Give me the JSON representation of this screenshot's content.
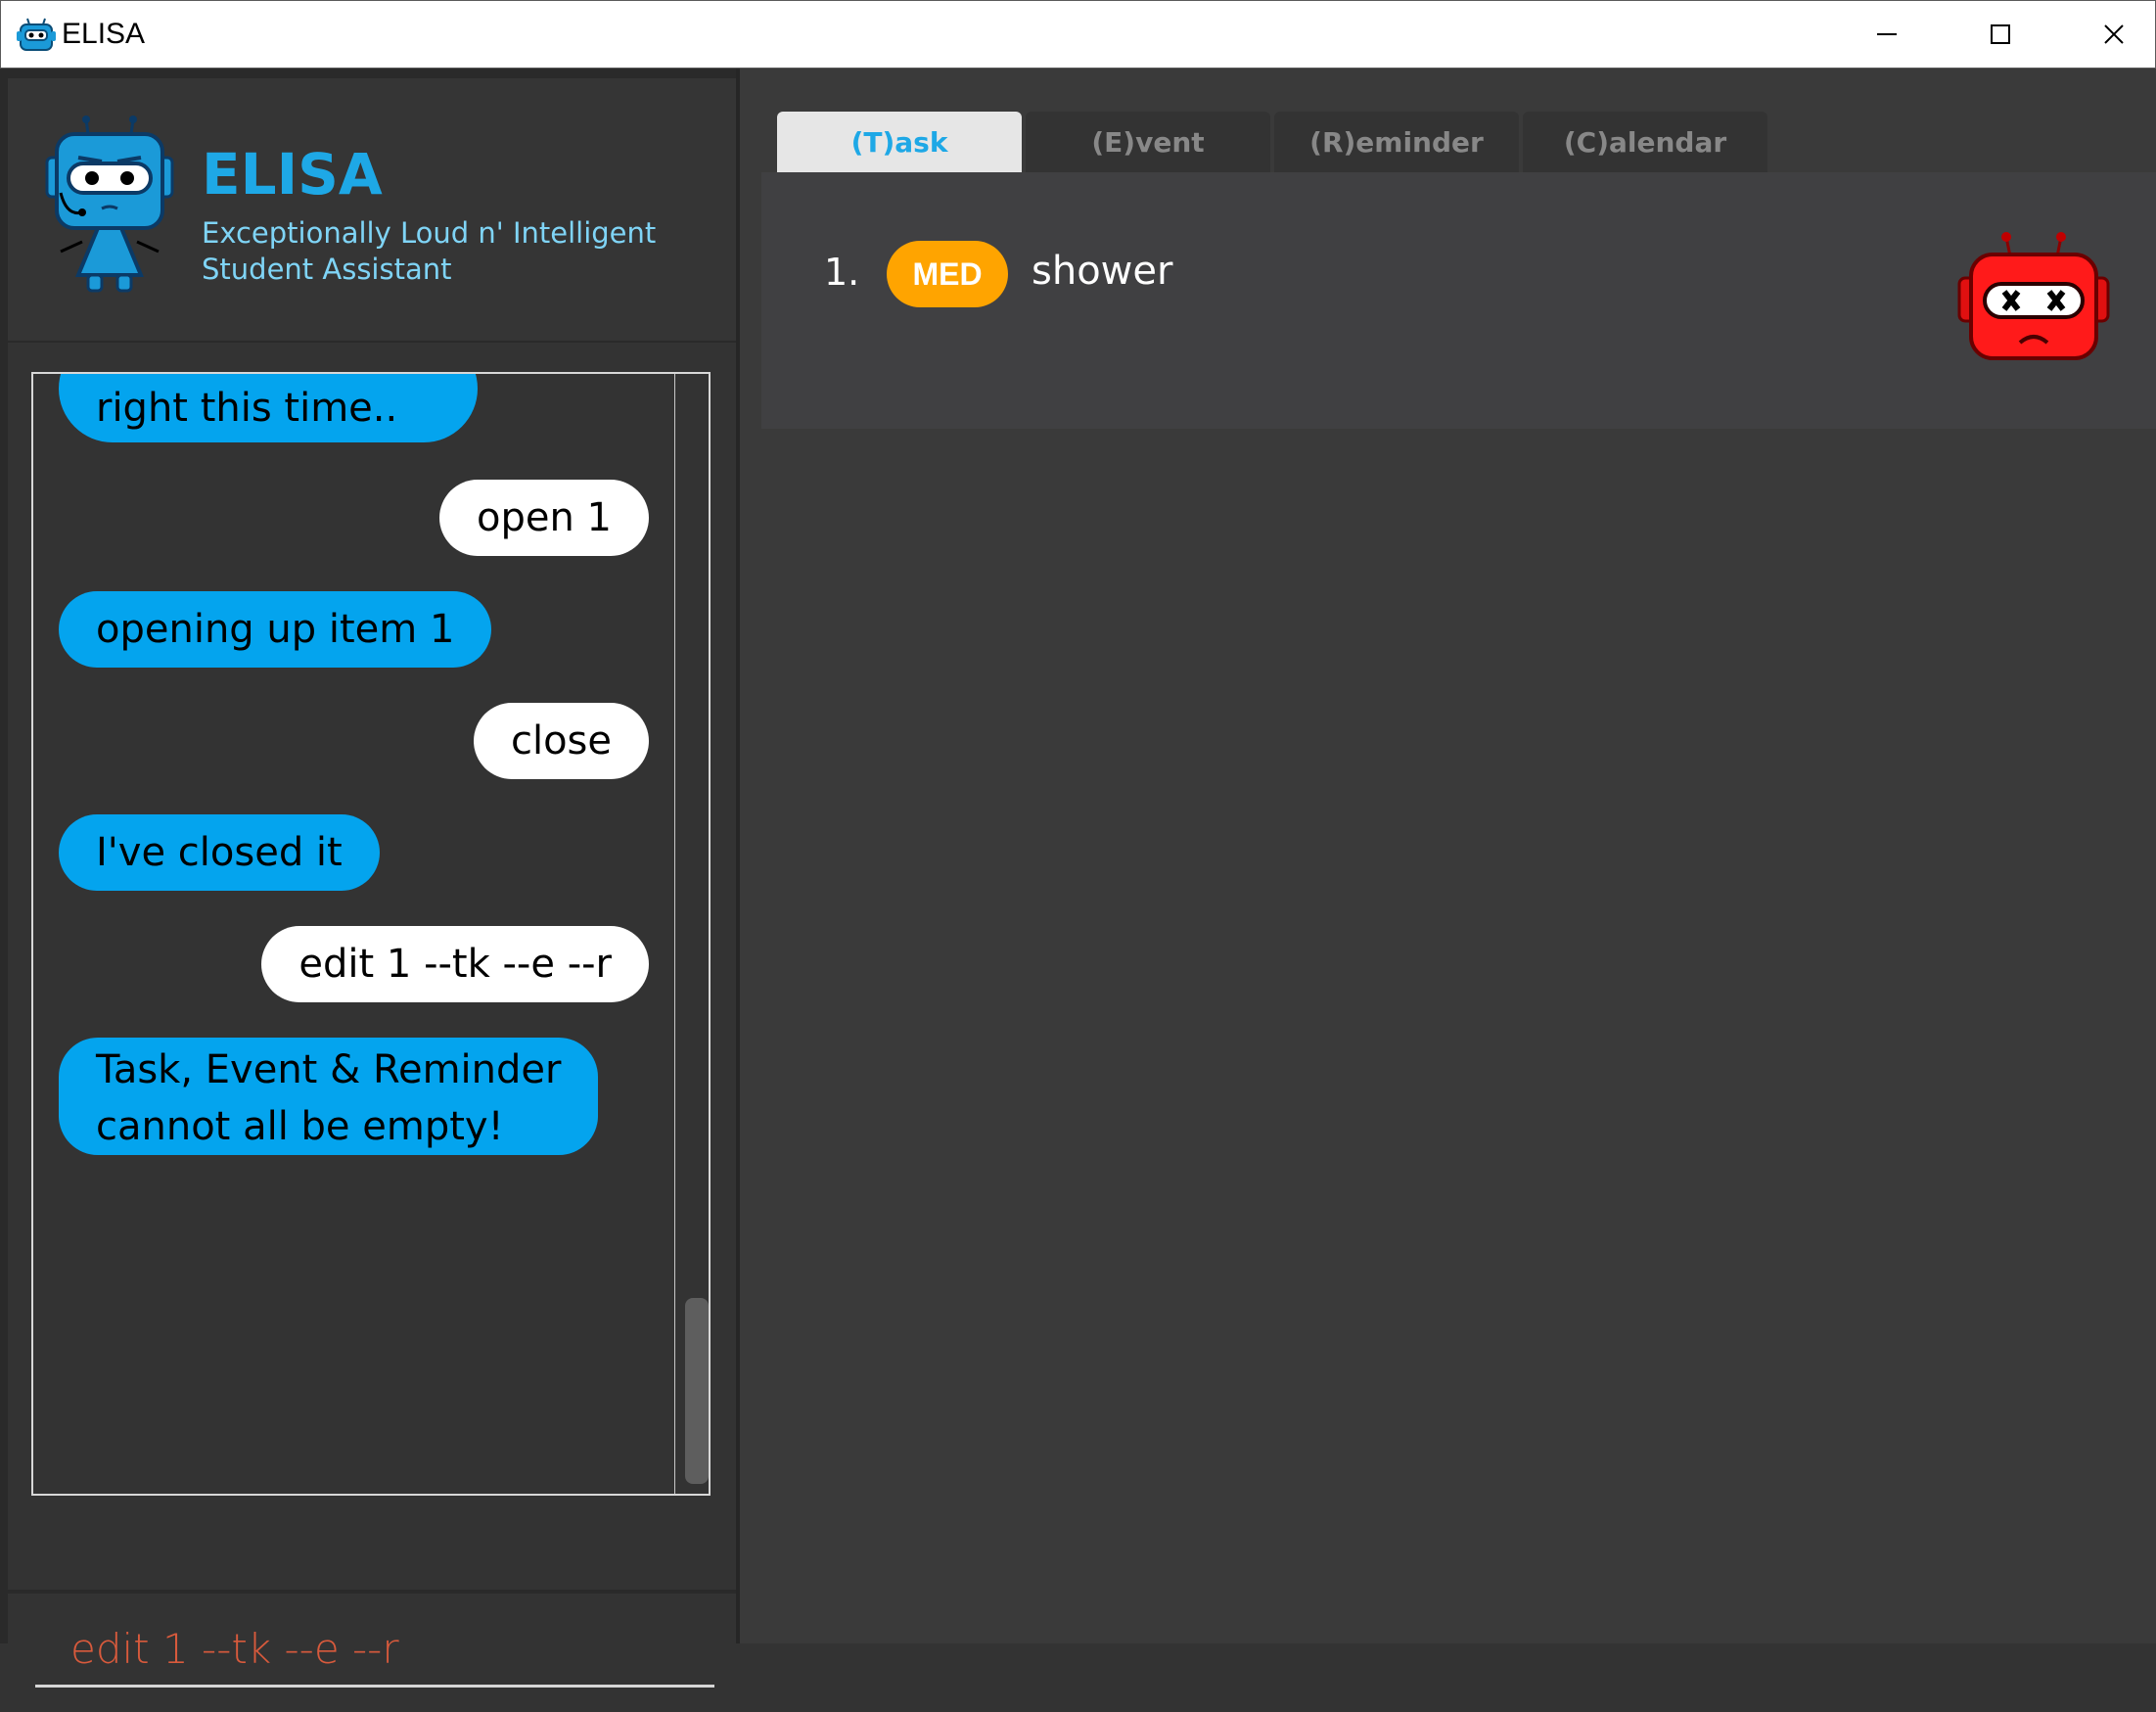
{
  "window": {
    "title": "ELISA",
    "controls": [
      "minimize",
      "maximize",
      "close"
    ]
  },
  "header": {
    "brand": "ELISA",
    "subtitle_line1": "Exceptionally Loud n' Intelligent",
    "subtitle_line2": "Student Assistant",
    "mascot_icon": "blue-robot-mascot"
  },
  "chat": {
    "messages": [
      {
        "sender": "elisa",
        "lines": [
          "right this time.."
        ]
      },
      {
        "sender": "user",
        "lines": [
          "open 1"
        ]
      },
      {
        "sender": "elisa",
        "lines": [
          "opening up item 1"
        ]
      },
      {
        "sender": "user",
        "lines": [
          "close"
        ]
      },
      {
        "sender": "elisa",
        "lines": [
          "I've closed it"
        ]
      },
      {
        "sender": "user",
        "lines": [
          "edit 1 --tk --e --r"
        ]
      },
      {
        "sender": "elisa",
        "lines": [
          "Task, Event & Reminder",
          "cannot all be empty!"
        ]
      }
    ]
  },
  "command": {
    "value": "edit 1 --tk --e --r"
  },
  "tabs": [
    {
      "label": "(T)ask",
      "active": true
    },
    {
      "label": "(E)vent",
      "active": false
    },
    {
      "label": "(R)eminder",
      "active": false
    },
    {
      "label": "(C)alendar",
      "active": false
    }
  ],
  "tasks": [
    {
      "index": "1.",
      "priority": "MED",
      "description": "shower",
      "status_icon": "red-robot-x-eyes-icon"
    }
  ],
  "colors": {
    "accent": "#1ea8e6",
    "elisa_bubble": "#04a4ee",
    "user_bubble": "#ffffff",
    "priority_med": "#ffa400",
    "input_text": "#d85a3c"
  }
}
